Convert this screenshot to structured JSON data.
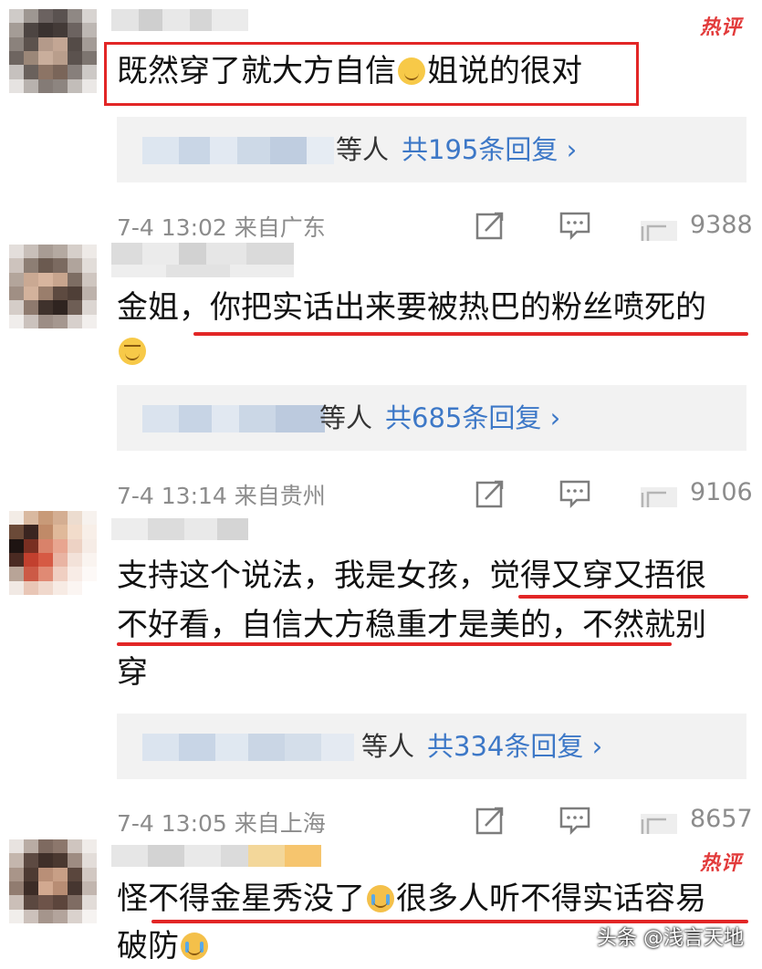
{
  "hot_badge": "热评",
  "comments": [
    {
      "text": "既然穿了就大方自信",
      "emoji": "smile",
      "text2": "姐说的很对",
      "replies_who": "等人",
      "replies_count": "共195条回复 ›",
      "time": "7-4 13:02",
      "location": "来自广东",
      "likes": "9388"
    },
    {
      "text": "金姐，你把实话出来要被热巴的粉丝喷死的",
      "emoji": "laugh",
      "replies_who": "等人",
      "replies_count": "共685条回复 ›",
      "time": "7-4 13:14",
      "location": "来自贵州",
      "likes": "9106"
    },
    {
      "line1": "支持这个说法，我是女孩，觉得又穿又捂很",
      "line2": "不好看，自信大方稳重才是美的，不然就别",
      "line3": "穿",
      "replies_who": "等人",
      "replies_count": "共334条回复 ›",
      "time": "7-4 13:05",
      "location": "来自上海",
      "likes": "8657"
    },
    {
      "text": "怪不得金星秀没了",
      "emoji": "cry",
      "text2": "很多人听不得实话容易",
      "line2": "破防"
    }
  ],
  "icons": {
    "share": "share-icon",
    "reply": "comment-icon",
    "like": "like-icon"
  },
  "watermark": "头条 @浅言天地",
  "colors": {
    "hot": "#e23b3b",
    "link": "#3d78c7",
    "meta": "#8c8c8c",
    "reply_bg": "#f2f2f2",
    "annotation": "#e22626"
  }
}
